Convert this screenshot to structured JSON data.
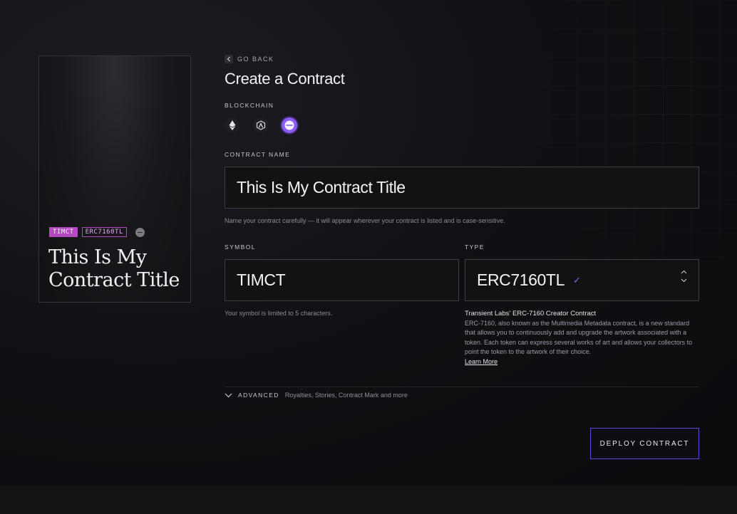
{
  "preview": {
    "symbol": "TIMCT",
    "type": "ERC7160TL",
    "title": "This Is My Contract Title",
    "chain_icon": "base-chain-icon"
  },
  "form": {
    "back_label": "GO BACK",
    "title": "Create a Contract",
    "blockchain_label": "BLOCKCHAIN",
    "blockchains": [
      {
        "icon": "ethereum-icon",
        "selected": false
      },
      {
        "icon": "arbitrum-icon",
        "selected": false
      },
      {
        "icon": "base-icon",
        "selected": true
      }
    ],
    "contract_name_label": "CONTRACT NAME",
    "contract_name_value": "This Is My Contract Title",
    "contract_name_hint": "Name your contract carefully — it will appear wherever your contract is listed and is case-sensitive.",
    "symbol_label": "SYMBOL",
    "symbol_value": "TIMCT",
    "symbol_hint": "Your symbol is limited to 5 characters.",
    "type_label": "TYPE",
    "type_value": "ERC7160TL",
    "type_description_title": "Transient Labs' ERC-7160 Creator Contract",
    "type_description": "ERC-7160, also known as the Multimedia Metadata contract, is a new standard that allows you to continuously add and upgrade the artwork associated with a token. Each token can express several works of art and allows your collectors to point the token to the artwork of their choice.",
    "learn_more": "Learn More",
    "advanced_label": "ADVANCED",
    "advanced_desc": "Royalties, Stories, Contract Mark and more",
    "deploy_label": "DEPLOY CONTRACT"
  },
  "colors": {
    "accent": "#8b5cf6",
    "badge": "#b24bc0"
  }
}
